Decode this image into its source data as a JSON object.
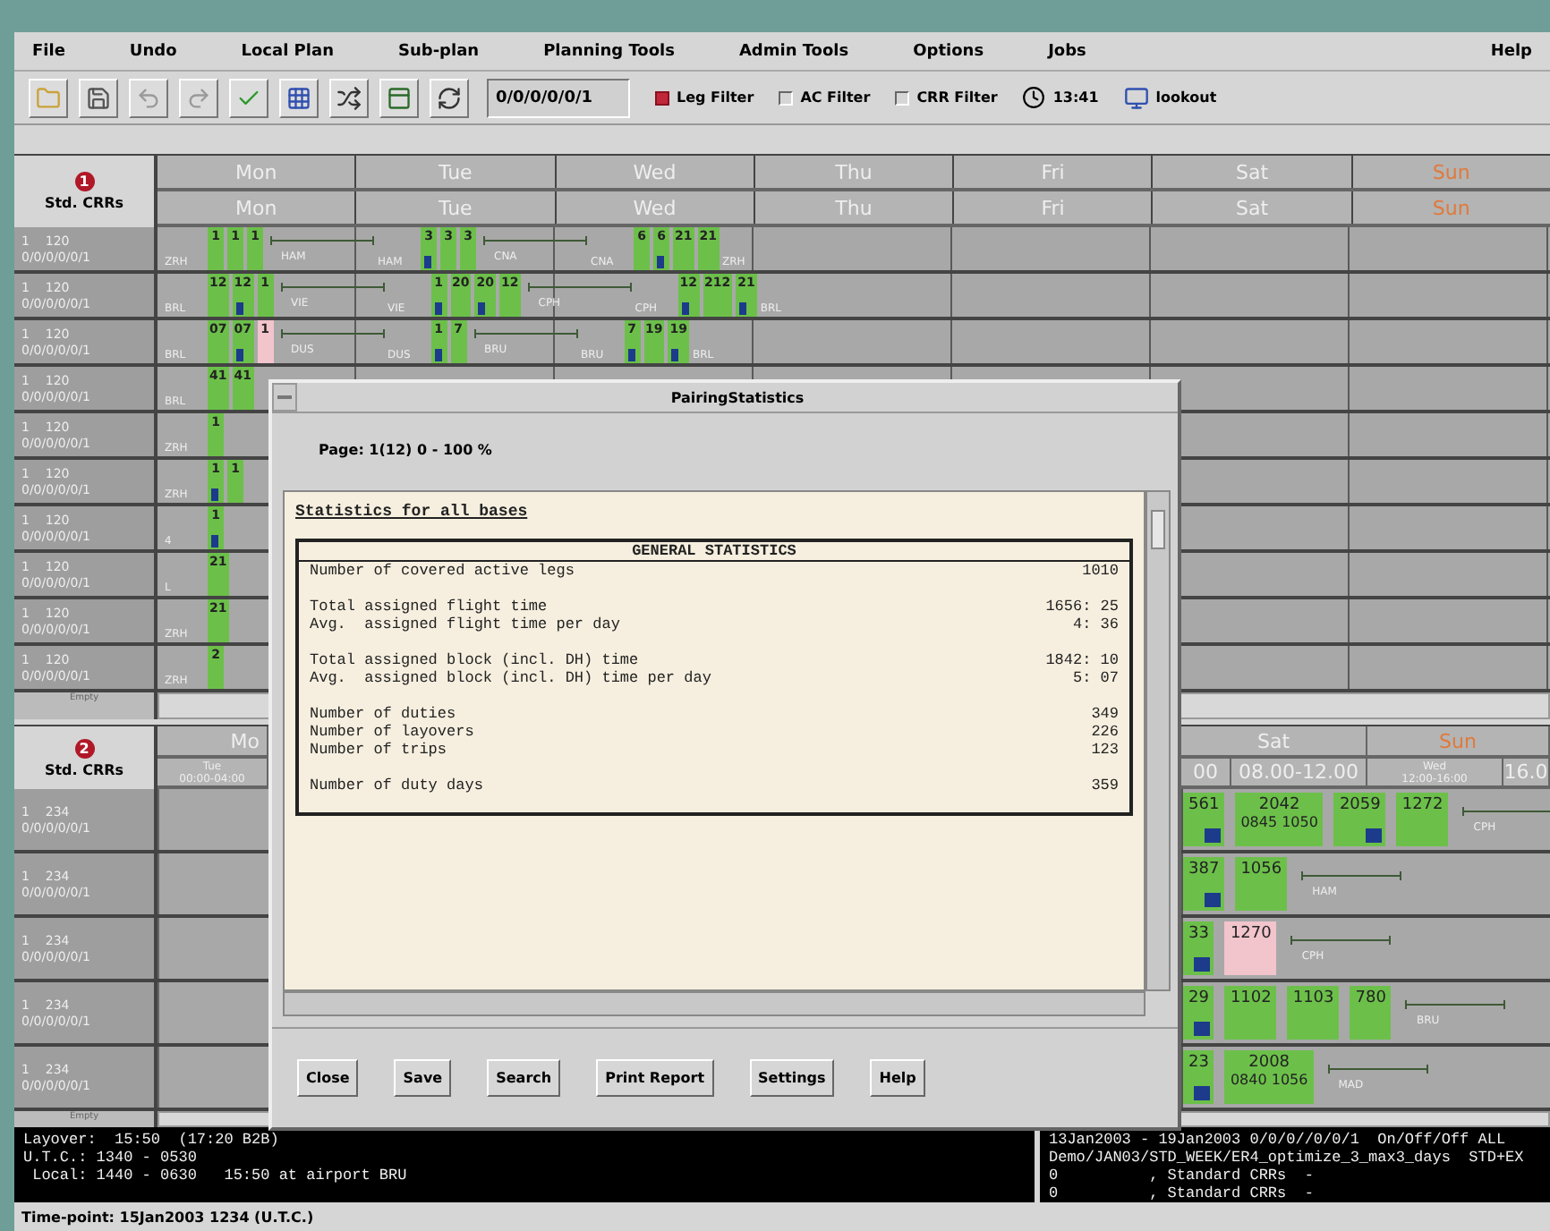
{
  "menu": [
    {
      "label": "File"
    },
    {
      "label": "Undo"
    },
    {
      "label": "Local Plan"
    },
    {
      "label": "Sub-plan"
    },
    {
      "label": "Planning Tools"
    },
    {
      "label": "Admin Tools"
    },
    {
      "label": "Options"
    },
    {
      "label": "Jobs"
    },
    {
      "label": "Help"
    }
  ],
  "toolbar": {
    "date_field": "0/0/0/0/0/1",
    "filters": [
      {
        "label": "Leg Filter",
        "checked": true
      },
      {
        "label": "AC Filter",
        "checked": false
      },
      {
        "label": "CRR Filter",
        "checked": false
      }
    ],
    "clock": "13:41",
    "host": "lookout"
  },
  "upper_gantt": {
    "panel_number": "1",
    "title": "Std. CRRs",
    "days": [
      {
        "label": "Mon",
        "holiday": false
      },
      {
        "label": "Tue",
        "holiday": false
      },
      {
        "label": "Wed",
        "holiday": false
      },
      {
        "label": "Thu",
        "holiday": false
      },
      {
        "label": "Fri",
        "holiday": false
      },
      {
        "label": "Sat",
        "holiday": false
      },
      {
        "label": "Sun",
        "holiday": true
      }
    ],
    "subdays": [
      {
        "label": "Mon",
        "holiday": false
      },
      {
        "label": "Tue",
        "holiday": false
      },
      {
        "label": "Wed",
        "holiday": false
      },
      {
        "label": "Thu",
        "holiday": false
      },
      {
        "label": "Fri",
        "holiday": false
      },
      {
        "label": "Sat",
        "holiday": false
      },
      {
        "label": "Sun",
        "holiday": true
      }
    ],
    "footer": "Empty",
    "rows": [
      {
        "count": "1",
        "id": "120",
        "pattern": "0/0/0/0/0/1",
        "segments": [
          {
            "kind": "station",
            "text": "ZRH"
          },
          {
            "kind": "leg",
            "text": "1",
            "color": "#6cc04a",
            "tick": false
          },
          {
            "kind": "leg",
            "text": "1",
            "color": "#6cc04a",
            "tick": false
          },
          {
            "kind": "leg",
            "text": "1",
            "color": "#6cc04a",
            "tick": false
          },
          {
            "kind": "layover",
            "text": "HAM"
          },
          {
            "kind": "station",
            "text": "HAM"
          },
          {
            "kind": "leg",
            "text": "3",
            "color": "#6cc04a",
            "tick": true
          },
          {
            "kind": "leg",
            "text": "3",
            "color": "#6cc04a",
            "tick": false
          },
          {
            "kind": "leg",
            "text": "3",
            "color": "#6cc04a",
            "tick": false
          },
          {
            "kind": "layover",
            "text": "CNA"
          },
          {
            "kind": "station",
            "text": "CNA"
          },
          {
            "kind": "leg",
            "text": "6",
            "color": "#6cc04a",
            "tick": false
          },
          {
            "kind": "leg",
            "text": "6",
            "color": "#6cc04a",
            "tick": true
          },
          {
            "kind": "leg",
            "text": "21",
            "color": "#6cc04a",
            "tick": false
          },
          {
            "kind": "leg",
            "text": "21",
            "color": "#6cc04a",
            "tick": false
          },
          {
            "kind": "station",
            "text": "ZRH"
          }
        ]
      },
      {
        "count": "1",
        "id": "120",
        "pattern": "0/0/0/0/0/1",
        "segments": [
          {
            "kind": "station",
            "text": "BRL"
          },
          {
            "kind": "leg",
            "text": "12",
            "color": "#6cc04a",
            "tick": false
          },
          {
            "kind": "leg",
            "text": "12",
            "color": "#6cc04a",
            "tick": true
          },
          {
            "kind": "leg",
            "text": "1",
            "color": "#6cc04a",
            "tick": false
          },
          {
            "kind": "layover",
            "text": "VIE"
          },
          {
            "kind": "station",
            "text": "VIE"
          },
          {
            "kind": "leg",
            "text": "1",
            "color": "#6cc04a",
            "tick": true
          },
          {
            "kind": "leg",
            "text": "20",
            "color": "#6cc04a",
            "tick": false
          },
          {
            "kind": "leg",
            "text": "20",
            "color": "#6cc04a",
            "tick": true
          },
          {
            "kind": "leg",
            "text": "12",
            "color": "#6cc04a",
            "tick": false
          },
          {
            "kind": "layover",
            "text": "CPH"
          },
          {
            "kind": "station",
            "text": "CPH"
          },
          {
            "kind": "leg",
            "text": "12",
            "color": "#6cc04a",
            "tick": true
          },
          {
            "kind": "leg",
            "text": "212",
            "color": "#6cc04a",
            "tick": false
          },
          {
            "kind": "leg",
            "text": "21",
            "color": "#6cc04a",
            "tick": true
          },
          {
            "kind": "station",
            "text": "BRL"
          }
        ]
      },
      {
        "count": "1",
        "id": "120",
        "pattern": "0/0/0/0/0/1",
        "segments": [
          {
            "kind": "station",
            "text": "BRL"
          },
          {
            "kind": "leg",
            "text": "07",
            "color": "#6cc04a",
            "tick": false
          },
          {
            "kind": "leg",
            "text": "07",
            "color": "#6cc04a",
            "tick": true
          },
          {
            "kind": "leg",
            "text": "1",
            "color": "#f2c4cc",
            "tick": false
          },
          {
            "kind": "layover",
            "text": "DUS"
          },
          {
            "kind": "station",
            "text": "DUS"
          },
          {
            "kind": "leg",
            "text": "1",
            "color": "#6cc04a",
            "tick": true
          },
          {
            "kind": "leg",
            "text": "7",
            "color": "#6cc04a",
            "tick": false
          },
          {
            "kind": "layover",
            "text": "BRU"
          },
          {
            "kind": "station",
            "text": "BRU"
          },
          {
            "kind": "leg",
            "text": "7",
            "color": "#6cc04a",
            "tick": true
          },
          {
            "kind": "leg",
            "text": "19",
            "color": "#6cc04a",
            "tick": false
          },
          {
            "kind": "leg",
            "text": "19",
            "color": "#6cc04a",
            "tick": true
          },
          {
            "kind": "station",
            "text": "BRL"
          }
        ]
      },
      {
        "count": "1",
        "id": "120",
        "pattern": "0/0/0/0/0/1",
        "segments": [
          {
            "kind": "station",
            "text": "BRL"
          },
          {
            "kind": "leg",
            "text": "41",
            "color": "#6cc04a",
            "tick": false
          },
          {
            "kind": "leg",
            "text": "41",
            "color": "#6cc04a",
            "tick": false
          }
        ]
      },
      {
        "count": "1",
        "id": "120",
        "pattern": "0/0/0/0/0/1",
        "segments": [
          {
            "kind": "station",
            "text": "ZRH"
          },
          {
            "kind": "leg",
            "text": "1",
            "color": "#6cc04a",
            "tick": false
          }
        ]
      },
      {
        "count": "1",
        "id": "120",
        "pattern": "0/0/0/0/0/1",
        "segments": [
          {
            "kind": "station",
            "text": "ZRH"
          },
          {
            "kind": "leg",
            "text": "1",
            "color": "#6cc04a",
            "tick": true
          },
          {
            "kind": "leg",
            "text": "1",
            "color": "#6cc04a",
            "tick": false
          }
        ]
      },
      {
        "count": "1",
        "id": "120",
        "pattern": "0/0/0/0/0/1",
        "segments": [
          {
            "kind": "station",
            "text": "4"
          },
          {
            "kind": "leg",
            "text": "1",
            "color": "#6cc04a",
            "tick": true
          }
        ]
      },
      {
        "count": "1",
        "id": "120",
        "pattern": "0/0/0/0/0/1",
        "segments": [
          {
            "kind": "station",
            "text": "L"
          },
          {
            "kind": "leg",
            "text": "21",
            "color": "#6cc04a",
            "tick": false
          }
        ]
      },
      {
        "count": "1",
        "id": "120",
        "pattern": "0/0/0/0/0/1",
        "segments": [
          {
            "kind": "station",
            "text": "ZRH"
          },
          {
            "kind": "leg",
            "text": "21",
            "color": "#6cc04a",
            "tick": false
          }
        ]
      },
      {
        "count": "1",
        "id": "120",
        "pattern": "0/0/0/0/0/1",
        "segments": [
          {
            "kind": "station",
            "text": "ZRH"
          },
          {
            "kind": "leg",
            "text": "2",
            "color": "#6cc04a",
            "tick": false
          }
        ]
      }
    ]
  },
  "lower_gantt": {
    "panel_number": "2",
    "title": "Std. CRRs",
    "footer": "Empty",
    "days": [
      {
        "label": "Mo",
        "holiday": false
      },
      {
        "label": "Sat",
        "holiday": false
      },
      {
        "label": "Sun",
        "holiday": true
      }
    ],
    "slots": [
      {
        "label": "Tue",
        "sub": "00:00-04:00"
      },
      {
        "label": "00"
      },
      {
        "label": "08.00-12.00"
      },
      {
        "label": "Wed",
        "sub": "12:00-16:00"
      },
      {
        "label": "16.0"
      }
    ],
    "rows": [
      {
        "count": "1",
        "id": "234",
        "pattern": "0/0/0/0/0/1",
        "segments": [
          {
            "kind": "leg",
            "text": "561",
            "color": "#6cc04a",
            "tick": true
          },
          {
            "kind": "leg",
            "text": "2042",
            "sub": "0845 1050",
            "color": "#6cc04a",
            "tick": false
          },
          {
            "kind": "leg",
            "text": "2059",
            "color": "#6cc04a",
            "tick": true
          },
          {
            "kind": "leg",
            "text": "1272",
            "color": "#6cc04a",
            "tick": false
          },
          {
            "kind": "layover",
            "text": "CPH"
          }
        ]
      },
      {
        "count": "1",
        "id": "234",
        "pattern": "0/0/0/0/0/1",
        "segments": [
          {
            "kind": "leg",
            "text": "387",
            "color": "#6cc04a",
            "tick": true
          },
          {
            "kind": "leg",
            "text": "1056",
            "color": "#6cc04a",
            "tick": false
          },
          {
            "kind": "layover",
            "text": "HAM"
          }
        ]
      },
      {
        "count": "1",
        "id": "234",
        "pattern": "0/0/0/0/0/1",
        "segments": [
          {
            "kind": "leg",
            "text": "33",
            "color": "#6cc04a",
            "tick": true
          },
          {
            "kind": "leg",
            "text": "1270",
            "color": "#f2c4cc",
            "tick": false
          },
          {
            "kind": "layover",
            "text": "CPH"
          }
        ]
      },
      {
        "count": "1",
        "id": "234",
        "pattern": "0/0/0/0/0/1",
        "segments": [
          {
            "kind": "leg",
            "text": "29",
            "color": "#6cc04a",
            "tick": true
          },
          {
            "kind": "leg",
            "text": "1102",
            "color": "#6cc04a",
            "tick": false
          },
          {
            "kind": "leg",
            "text": "1103",
            "color": "#6cc04a",
            "tick": false
          },
          {
            "kind": "leg",
            "text": "780",
            "color": "#6cc04a",
            "tick": false
          },
          {
            "kind": "layover",
            "text": "BRU"
          }
        ]
      },
      {
        "count": "1",
        "id": "234",
        "pattern": "0/0/0/0/0/1",
        "segments": [
          {
            "kind": "leg",
            "text": "23",
            "color": "#6cc04a",
            "tick": true
          },
          {
            "kind": "leg",
            "text": "2008",
            "sub": "0840 1056",
            "color": "#6cc04a",
            "tick": false
          },
          {
            "kind": "layover",
            "text": "MAD"
          }
        ]
      }
    ]
  },
  "dialog": {
    "title": "PairingStatistics",
    "page": "Page: 1(12) 0 - 100 %",
    "heading": "Statistics for all bases",
    "table_title": "GENERAL STATISTICS",
    "groups": [
      [
        {
          "label": "Number of covered active legs",
          "value": "1010"
        }
      ],
      [
        {
          "label": "Total assigned flight time",
          "value": "1656: 25"
        },
        {
          "label": "Avg.  assigned flight time per day",
          "value": "4: 36"
        }
      ],
      [
        {
          "label": "Total assigned block (incl. DH) time",
          "value": "1842: 10"
        },
        {
          "label": "Avg.  assigned block (incl. DH) time per day",
          "value": "5: 07"
        }
      ],
      [
        {
          "label": "Number of duties",
          "value": "349"
        },
        {
          "label": "Number of layovers",
          "value": "226"
        },
        {
          "label": "Number of trips",
          "value": "123"
        }
      ],
      [
        {
          "label": "Number of duty days",
          "value": "359"
        }
      ]
    ],
    "buttons": [
      "Close",
      "Save",
      "Search",
      "Print Report",
      "Settings",
      "Help"
    ]
  },
  "info_left": [
    "Layover:  15:50  (17:20 B2B)",
    "U.T.C.: 1340 - 0530",
    " Local: 1440 - 0630   15:50 at airport BRU"
  ],
  "info_right": [
    "13Jan2003 - 19Jan2003 0/0/0//0/0/1  On/Off/Off ALL",
    "Demo/JAN03/STD_WEEK/ER4_optimize_3_max3_days  STD+EX",
    "0          , Standard CRRs  -",
    "0          , Standard CRRs  -"
  ],
  "status_bar": "Time-point: 15Jan2003 1234 (U.T.C.)"
}
